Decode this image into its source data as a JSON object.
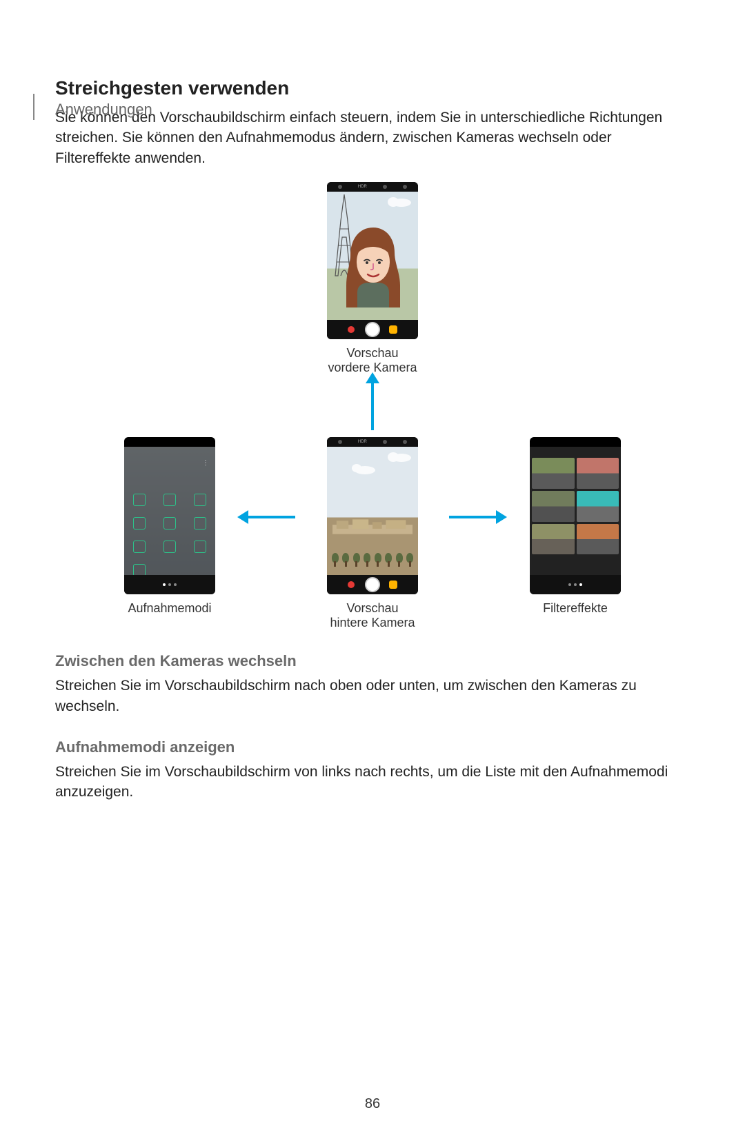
{
  "header": {
    "breadcrumb": "Anwendungen"
  },
  "section1": {
    "title": "Streichgesten verwenden",
    "body": "Sie können den Vorschaubildschirm einfach steuern, indem Sie in unterschiedliche Richtungen streichen. Sie können den Aufnahmemodus ändern, zwischen Kameras wechseln oder Filtereffekte anwenden."
  },
  "figure": {
    "captions": {
      "front": "Vorschau vordere Kamera",
      "modes": "Aufnahmemodi",
      "back": "Vorschau hintere Kamera",
      "filters": "Filtereffekte"
    },
    "topbar_labels": {
      "hdr": "HDR"
    }
  },
  "section2": {
    "title": "Zwischen den Kameras wechseln",
    "body": "Streichen Sie im Vorschaubildschirm nach oben oder unten, um zwischen den Kameras zu wechseln."
  },
  "section3": {
    "title": "Aufnahmemodi anzeigen",
    "body": "Streichen Sie im Vorschaubildschirm von links nach rechts, um die Liste mit den Aufnahmemodi anzuzeigen."
  },
  "page_number": "86"
}
